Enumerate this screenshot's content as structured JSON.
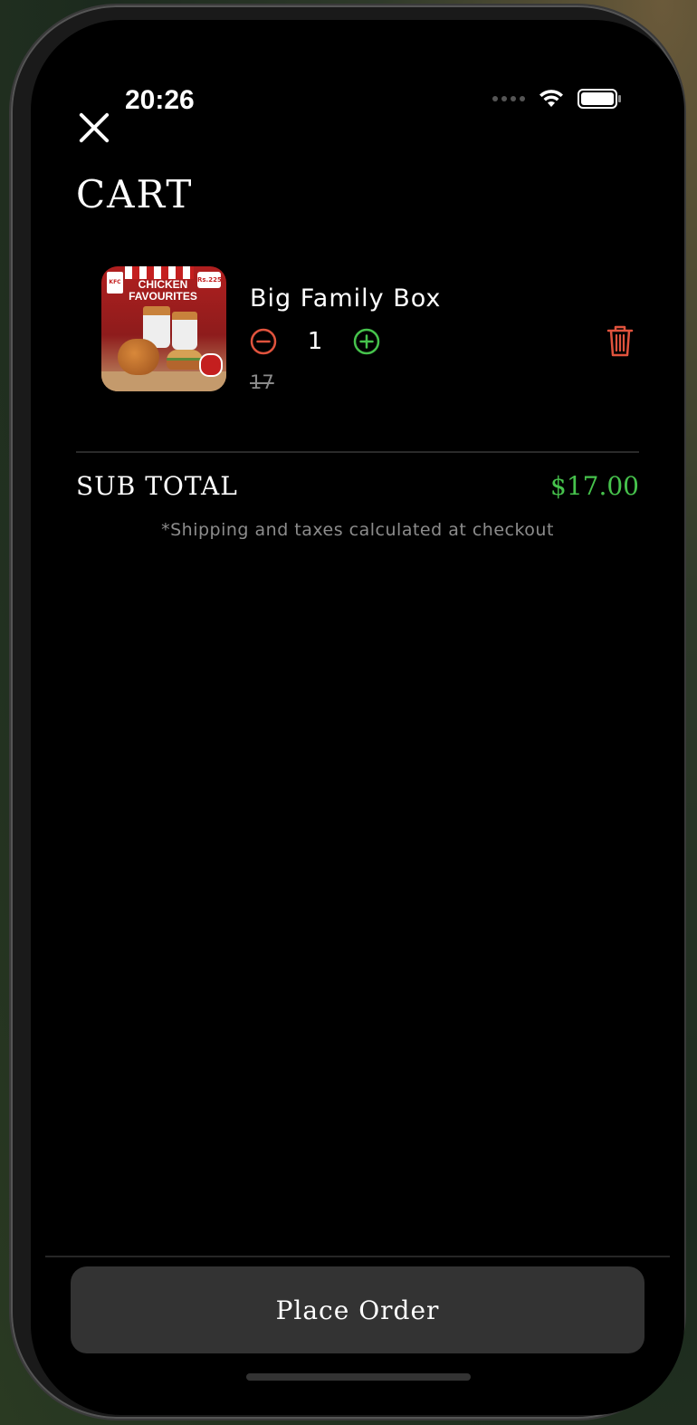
{
  "status_bar": {
    "time": "20:26"
  },
  "header": {
    "title": "CART"
  },
  "cart": {
    "items": [
      {
        "name": "Big Family Box",
        "quantity": "1",
        "original_price": "17",
        "image_text": {
          "brand": "CHICKEN FAVOURITES",
          "logo": "KFC",
          "price_tag": "Rs.225"
        }
      }
    ]
  },
  "summary": {
    "subtotal_label": "SUB TOTAL",
    "subtotal_value": "$17.00",
    "note": "*Shipping and taxes calculated at checkout"
  },
  "footer": {
    "place_order_label": "Place Order"
  },
  "colors": {
    "accent_green": "#46c24c",
    "danger_red": "#e0533d",
    "background": "#000000",
    "button_bg": "#333333"
  },
  "icons": [
    "close-icon",
    "minus-circle-icon",
    "plus-circle-icon",
    "trash-icon",
    "wifi-icon",
    "battery-icon",
    "signal-dots-icon"
  ]
}
